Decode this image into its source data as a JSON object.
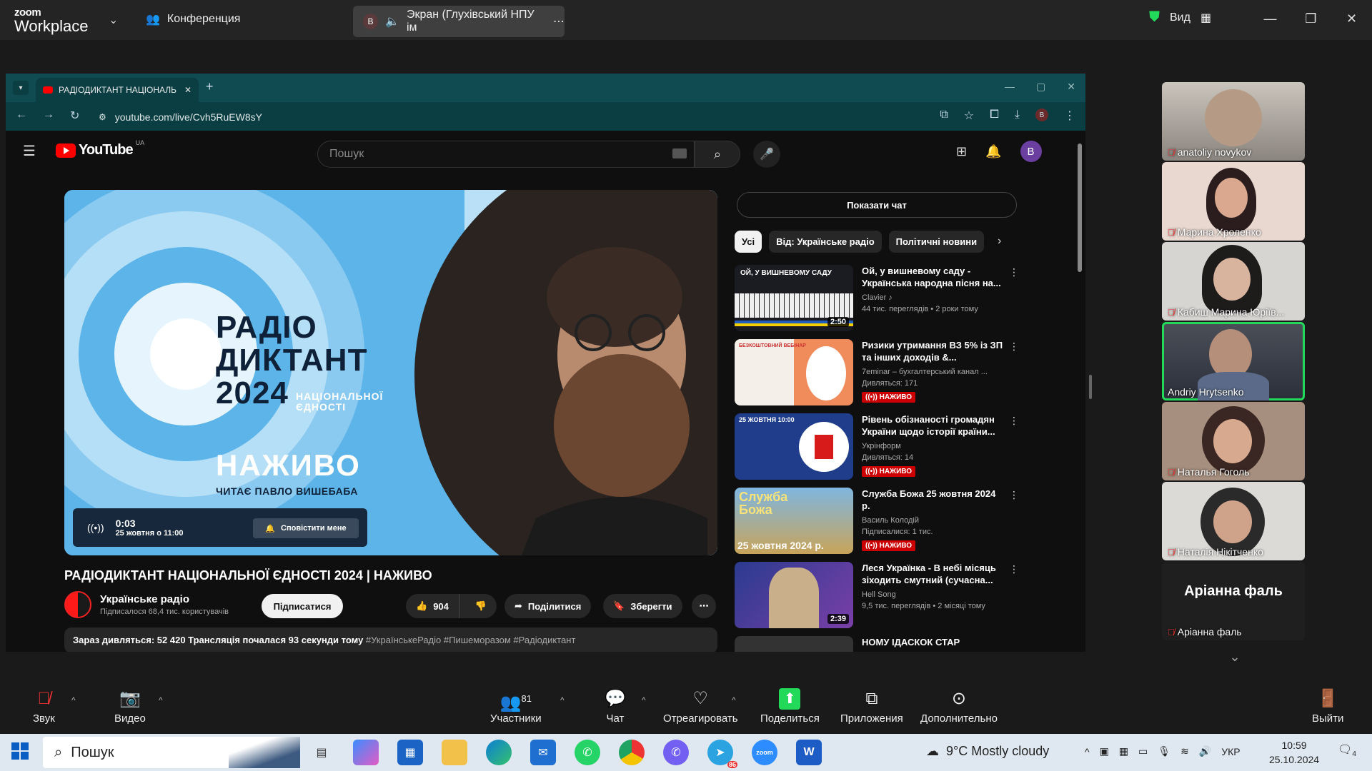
{
  "zoom": {
    "brand_top": "zoom",
    "brand_bottom": "Workplace",
    "meeting_label": "Конференция",
    "share_avatar": "B",
    "share_label": "Экран (Глухівський НПУ ім",
    "view_label": "Вид"
  },
  "browser": {
    "tab_title": "РАДІОДИКТАНТ НАЦІОНАЛЬ",
    "url": "youtube.com/live/Cvh5RuEW8sY",
    "profile_initial": "B"
  },
  "youtube": {
    "logo_text": "YouTube",
    "region": "UA",
    "search_placeholder": "Пошук",
    "avatar_initial": "B",
    "player": {
      "line1": "РАДІО",
      "line2": "ДИКТАНТ",
      "line3": "2024",
      "sub1": "НАЦІОНАЛЬНОЇ",
      "sub2": "ЄДНОСТІ",
      "live": "НАЖИВО",
      "reader": "ЧИТАЄ ПАВЛО ВИШЕБАБА",
      "time": "0:03",
      "date": "25 жовтня о 11:00",
      "notify": "Сповістити мене"
    },
    "video_title": "РАДІОДИКТАНТ НАЦІОНАЛЬНОЇ ЄДНОСТІ 2024 | НАЖИВО",
    "channel": "Українське радіо",
    "subscribers": "Підписалося 68,4 тис. користувачів",
    "subscribe": "Підписатися",
    "likes": "904",
    "share": "Поділитися",
    "save": "Зберегти",
    "desc_main": "Зараз дивляться: 52 420  Трансляція почалася 93 секунди тому ",
    "desc_tags": "#УкраїнськеРадіо #Пишеморазом #Радіодиктант",
    "show_chat": "Показати чат",
    "chips": [
      "Усі",
      "Від: Українське радіо",
      "Політичні новини"
    ],
    "recs": [
      {
        "title": "Ой, у вишневому саду - Українська народна пісня на...",
        "channel": "Clavier ♪",
        "meta": "44 тис. переглядів • 2 роки тому",
        "duration": "2:50",
        "live": "",
        "thumb_text": "ОЙ, У ВИШНЕВОМУ САДУ"
      },
      {
        "title": "Ризики утримання ВЗ 5% із ЗП та інших доходів &...",
        "channel": "7eminar – бухгалтерський канал ...",
        "meta": "Дивляться: 171",
        "duration": "",
        "live": "((•)) НАЖИВО",
        "thumb_text": "БЕЗКОШТОВНИЙ ВЕБІНАР"
      },
      {
        "title": "Рівень обізнаності громадян України щодо історії країни...",
        "channel": "Укрінформ",
        "meta": "Дивляться: 14",
        "duration": "",
        "live": "((•)) НАЖИВО",
        "thumb_text": "25 ЖОВТНЯ 10:00"
      },
      {
        "title": "Служба Божа 25 жовтня 2024 р.",
        "channel": "Василь Колодій",
        "meta": "Підписалися: 1 тис.",
        "duration": "",
        "live": "((•)) НАЖИВО",
        "thumb_text": "Служба Божа",
        "thumb_text2": "25 жовтня 2024 р."
      },
      {
        "title": "Леся Українка - В небі місяць зіходить смутний (сучасна...",
        "channel": "Hell Song",
        "meta": "9,5 тис. переглядів • 2 місяці тому",
        "duration": "2:39",
        "live": "",
        "thumb_text": ""
      },
      {
        "title": "НОМУ ІДАСКОК СТАР",
        "channel": "",
        "meta": "",
        "duration": "",
        "live": "",
        "thumb_text": ""
      }
    ]
  },
  "participants": [
    {
      "name": "anatoliy novykov",
      "muted": true,
      "active": false
    },
    {
      "name": "Марина Хроленко",
      "muted": true,
      "active": false
    },
    {
      "name": "Кабиш Марина Юріїв...",
      "muted": true,
      "active": false
    },
    {
      "name": "Andriy Hrytsenko",
      "muted": false,
      "active": true
    },
    {
      "name": "Наталья Гоголь",
      "muted": true,
      "active": false
    },
    {
      "name": "Наталія Нікітченко",
      "muted": true,
      "active": false
    },
    {
      "name": "Аріанна фаль",
      "muted": true,
      "active": false,
      "big": "Аріанна фаль"
    }
  ],
  "toolbar": {
    "audio": "Звук",
    "video": "Видео",
    "participants": "Участники",
    "participants_count": "81",
    "chat": "Чат",
    "react": "Отреагировать",
    "share": "Поделиться",
    "apps": "Приложения",
    "more": "Дополнительно",
    "leave": "Выйти"
  },
  "taskbar": {
    "search": "Пошук",
    "weather": "9°C  Mostly cloudy",
    "lang": "УКР",
    "time": "10:59",
    "date": "25.10.2024",
    "notifications": "4",
    "telegram_badge": "86"
  },
  "colors": {
    "zoom_green": "#23d959",
    "yt_red": "#ff0000",
    "browser_teal": "#0f4b50",
    "mute_red": "#e33333"
  }
}
